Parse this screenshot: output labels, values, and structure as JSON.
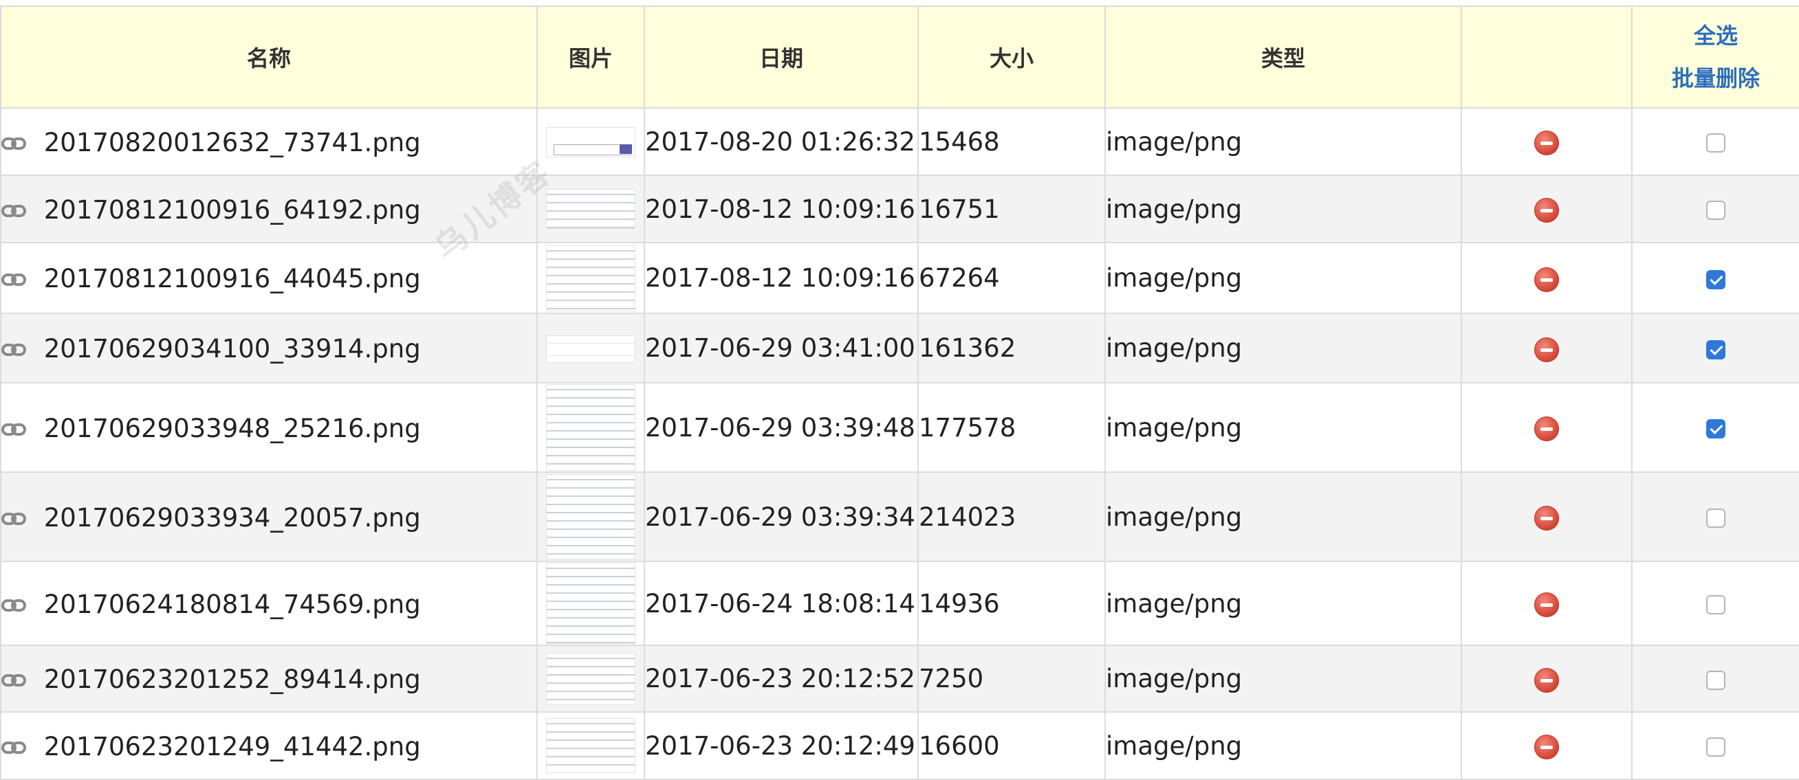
{
  "table": {
    "headers": {
      "name": "名称",
      "image": "图片",
      "date": "日期",
      "size": "大小",
      "type": "类型",
      "actions": "",
      "select_all": "全选",
      "batch_delete": "批量删除"
    },
    "rows": [
      {
        "name": "20170820012632_73741.png",
        "date": "2017-08-20 01:26:32",
        "size": "15468",
        "type": "image/png",
        "checked": false
      },
      {
        "name": "20170812100916_64192.png",
        "date": "2017-08-12 10:09:16",
        "size": "16751",
        "type": "image/png",
        "checked": false
      },
      {
        "name": "20170812100916_44045.png",
        "date": "2017-08-12 10:09:16",
        "size": "67264",
        "type": "image/png",
        "checked": true
      },
      {
        "name": "20170629034100_33914.png",
        "date": "2017-06-29 03:41:00",
        "size": "161362",
        "type": "image/png",
        "checked": true
      },
      {
        "name": "20170629033948_25216.png",
        "date": "2017-06-29 03:39:48",
        "size": "177578",
        "type": "image/png",
        "checked": true
      },
      {
        "name": "20170629033934_20057.png",
        "date": "2017-06-29 03:39:34",
        "size": "214023",
        "type": "image/png",
        "checked": false
      },
      {
        "name": "20170624180814_74569.png",
        "date": "2017-06-24 18:08:14",
        "size": "14936",
        "type": "image/png",
        "checked": false
      },
      {
        "name": "20170623201252_89414.png",
        "date": "2017-06-23 20:12:52",
        "size": "7250",
        "type": "image/png",
        "checked": false
      },
      {
        "name": "20170623201249_41442.png",
        "date": "2017-06-23 20:12:49",
        "size": "16600",
        "type": "image/png",
        "checked": false
      }
    ]
  },
  "watermark": "乌儿博客",
  "icons": {
    "link": "link-icon",
    "delete": "delete-icon"
  },
  "colors": {
    "header_bg": "#ffffdc",
    "link": "#2c6fbb",
    "checkbox_checked": "#2f78d8",
    "delete": "#d2412f",
    "row_alt": "#f3f3f3"
  }
}
